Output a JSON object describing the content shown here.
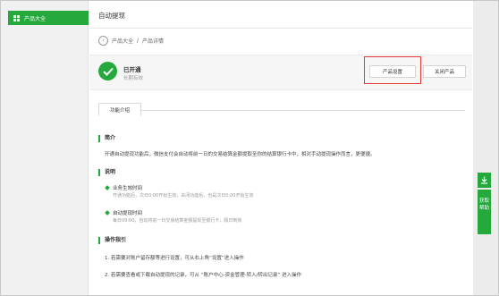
{
  "sidebar": {
    "items": [
      {
        "label": "产品大全",
        "icon": "grid-icon",
        "active": true
      }
    ]
  },
  "header": {
    "title": "自动提现"
  },
  "breadcrumb": {
    "back_icon": "chevron-left-icon",
    "parent": "产品大全",
    "separator": "/",
    "current": "产品详情"
  },
  "status": {
    "icon": "check-icon",
    "title": "已开通",
    "subtitle": "长期有效"
  },
  "actions": {
    "settings_label": "产品设置",
    "close_label": "关闭产品"
  },
  "tabs": [
    {
      "label": "功能介绍",
      "active": true
    }
  ],
  "sections": {
    "intro": {
      "heading": "简介",
      "text": "开通自动提现功能后，微信支付会自动将前一日的交易结算金额提取至你的结算银行卡中，相对手动提现操作而言，更便捷。"
    },
    "notes": {
      "heading": "说明",
      "items": [
        {
          "title": "业务生效时间",
          "desc": "开通功能后，次日0:00开始生效；关闭功能后，也是次日0:00开始生效"
        },
        {
          "title": "自动提现时间",
          "desc": "每日09:00，自动将前一日交易结算金额提现至银行卡，隔日到账"
        }
      ]
    },
    "guide": {
      "heading": "操作指引",
      "steps": [
        "1. 若需要对账户留存额等进行设置，可从右上角“设置”进入操作",
        "2. 若需要查看或下载自动提现的记录，可从 “账户中心-资金管理-转入/转出记录” 进入操作"
      ]
    }
  },
  "float_tools": {
    "download_icon": "download-icon",
    "label_line1": "获取",
    "label_line2": "帮助"
  },
  "colors": {
    "accent": "#25a83c",
    "highlight": "#e03a3a"
  }
}
